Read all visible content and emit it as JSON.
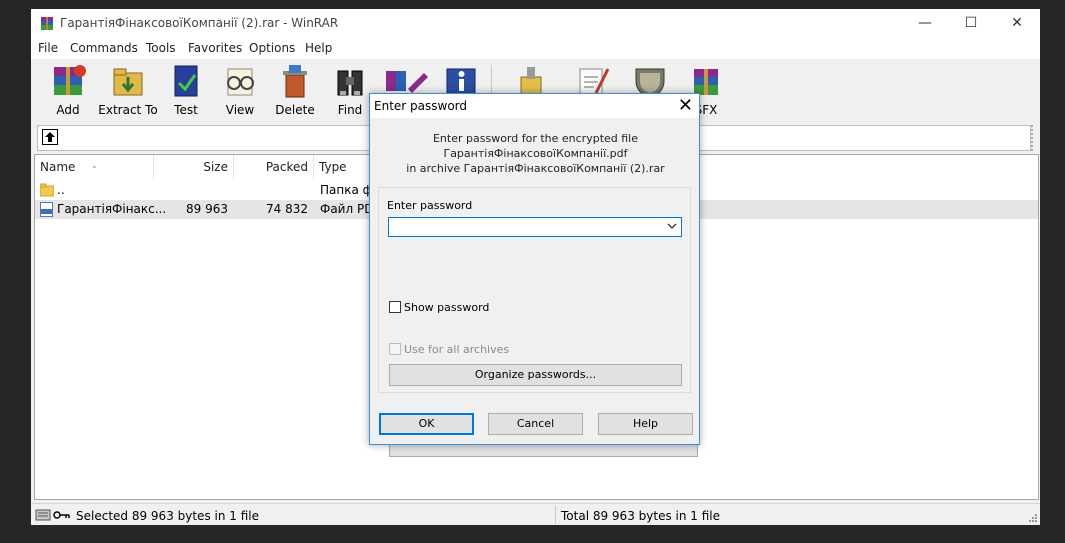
{
  "window": {
    "title": "ГарантіяФінаксовоїКомпанії (2).rar - WinRAR",
    "minimize": "—",
    "maximize": "☐",
    "close": "✕"
  },
  "menu": [
    "File",
    "Commands",
    "Tools",
    "Favorites",
    "Options",
    "Help"
  ],
  "toolbar": {
    "add": "Add",
    "extract": "Extract To",
    "test": "Test",
    "view": "View",
    "delete": "Delete",
    "find": "Find",
    "sfx": "SFX"
  },
  "columns": {
    "name": "Name",
    "size": "Size",
    "packed": "Packed",
    "type": "Type"
  },
  "files": [
    {
      "name": "..",
      "size": "",
      "packed": "",
      "type": "Папка фа"
    },
    {
      "name": "ГарантіяФінакс...",
      "size": "89 963",
      "packed": "74 832",
      "type": "Файл PDF"
    }
  ],
  "status": {
    "left": "Selected 89 963 bytes in 1 file",
    "right": "Total 89 963 bytes in 1 file"
  },
  "dialog": {
    "title": "Enter password",
    "close": "✕",
    "info_line1": "Enter password for the encrypted file",
    "info_line2": "ГарантіяФінаксовоїКомпанії.pdf",
    "info_line3": "in archive ГарантіяФінаксовоїКомпанії (2).rar",
    "password_label": "Enter password",
    "password_value": "",
    "show_password": "Show password",
    "use_for_all": "Use for all archives",
    "organize": "Organize passwords...",
    "ok": "OK",
    "cancel": "Cancel",
    "help": "Help"
  },
  "colors": {
    "accent": "#0078d7",
    "dialog_border": "#3a8fd9",
    "background": "#262626"
  }
}
